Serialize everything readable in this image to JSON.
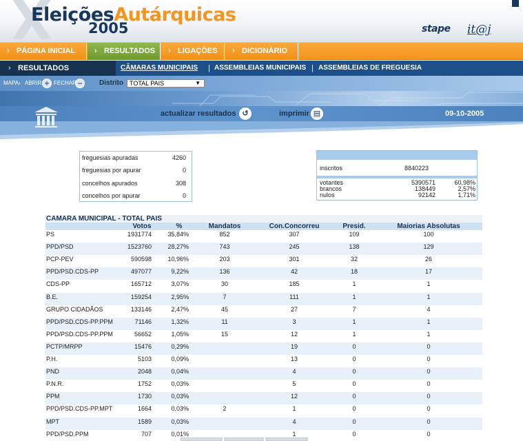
{
  "header": {
    "title_main": "Eleições",
    "title_accent": "Autárquicas",
    "title_year": "2005",
    "logo_stape": "stape",
    "logo_itij": "it@j"
  },
  "nav": {
    "items": [
      {
        "label": "PÁGINA INICIAL"
      },
      {
        "label": "RESULTADOS"
      },
      {
        "label": "LIGAÇÕES"
      },
      {
        "label": "DICIONÁRIO"
      }
    ]
  },
  "subnav": {
    "section": "RESULTADOS",
    "links": [
      {
        "label": "CÂMARAS MUNICIPAIS"
      },
      {
        "label": "ASSEMBLEIAS MUNICIPAIS"
      },
      {
        "label": "ASSEMBLEIAS DE FREGUESIA"
      }
    ],
    "separator": "|"
  },
  "toolbar": {
    "mapa_label": "MAPA",
    "abrir_label": "ABRIR",
    "fechar_label": "FECHAR",
    "distrito_label": "Distrito",
    "distrito_value": "TOTAL PAIS"
  },
  "actions": {
    "update_label": "actualizar resultados",
    "print_label": "imprimir",
    "date": "09-10-2005"
  },
  "summary_left": [
    {
      "label": "freguesias apuradas",
      "value": "4260"
    },
    {
      "label": "freguesias por apurar",
      "value": "0"
    },
    {
      "label": "concelhos apurados",
      "value": "308"
    },
    {
      "label": "concelhos por apurar",
      "value": "0"
    }
  ],
  "summary_right": {
    "inscritos_label": "inscritos",
    "inscritos_value": "8840223",
    "rows": [
      {
        "label": "votantes",
        "value": "5390571",
        "pct": "60,98%"
      },
      {
        "label": "brancos",
        "value": "138449",
        "pct": "2,57%"
      },
      {
        "label": "nulos",
        "value": "92142",
        "pct": "1,71%"
      }
    ]
  },
  "results": {
    "title": "CAMARA MUNICIPAL - TOTAL PAIS",
    "headers": [
      "Votos",
      "%",
      "Mandatos",
      "Con.Concorreu",
      "Presid.",
      "Maiorias Absolutas"
    ],
    "rows": [
      {
        "party": "PS",
        "votos": "1931774",
        "pct": "35,84%",
        "mandatos": "852",
        "concorreu": "307",
        "presid": "109",
        "maiorias": "100"
      },
      {
        "party": "PPD/PSD",
        "votos": "1523760",
        "pct": "28,27%",
        "mandatos": "743",
        "concorreu": "245",
        "presid": "138",
        "maiorias": "129"
      },
      {
        "party": "PCP-PEV",
        "votos": "590598",
        "pct": "10,96%",
        "mandatos": "203",
        "concorreu": "301",
        "presid": "32",
        "maiorias": "26"
      },
      {
        "party": "PPD/PSD.CDS-PP",
        "votos": "497077",
        "pct": "9,22%",
        "mandatos": "136",
        "concorreu": "42",
        "presid": "18",
        "maiorias": "17"
      },
      {
        "party": "CDS-PP",
        "votos": "165712",
        "pct": "3,07%",
        "mandatos": "30",
        "concorreu": "185",
        "presid": "1",
        "maiorias": "1"
      },
      {
        "party": "B.E.",
        "votos": "159254",
        "pct": "2,95%",
        "mandatos": "7",
        "concorreu": "111",
        "presid": "1",
        "maiorias": "1"
      },
      {
        "party": "GRUPO CIDADÃOS",
        "votos": "133146",
        "pct": "2,47%",
        "mandatos": "45",
        "concorreu": "27",
        "presid": "7",
        "maiorias": "4"
      },
      {
        "party": "PPD/PSD.CDS-PP.PPM",
        "votos": "71146",
        "pct": "1,32%",
        "mandatos": "11",
        "concorreu": "3",
        "presid": "1",
        "maiorias": "1"
      },
      {
        "party": "PPD/PSD.CDS-PP.PPM",
        "votos": "56652",
        "pct": "1,05%",
        "mandatos": "15",
        "concorreu": "12",
        "presid": "1",
        "maiorias": "1"
      },
      {
        "party": "PCTP/MRPP",
        "votos": "15476",
        "pct": "0,29%",
        "mandatos": "",
        "concorreu": "19",
        "presid": "0",
        "maiorias": "0"
      },
      {
        "party": "P.H.",
        "votos": "5103",
        "pct": "0,09%",
        "mandatos": "",
        "concorreu": "13",
        "presid": "0",
        "maiorias": "0"
      },
      {
        "party": "PND",
        "votos": "2048",
        "pct": "0,04%",
        "mandatos": "",
        "concorreu": "4",
        "presid": "0",
        "maiorias": "0"
      },
      {
        "party": "P.N.R.",
        "votos": "1752",
        "pct": "0,03%",
        "mandatos": "",
        "concorreu": "5",
        "presid": "0",
        "maiorias": "0"
      },
      {
        "party": "PPM",
        "votos": "1730",
        "pct": "0,03%",
        "mandatos": "",
        "concorreu": "12",
        "presid": "0",
        "maiorias": "0"
      },
      {
        "party": "PPD/PSD.CDS-PP.MPT",
        "votos": "1664",
        "pct": "0,03%",
        "mandatos": "2",
        "concorreu": "1",
        "presid": "0",
        "maiorias": "0"
      },
      {
        "party": "MPT",
        "votos": "1589",
        "pct": "0,03%",
        "mandatos": "",
        "concorreu": "4",
        "presid": "0",
        "maiorias": "0"
      },
      {
        "party": "PPD/PSD.PPM",
        "votos": "707",
        "pct": "0,01%",
        "mandatos": "",
        "concorreu": "1",
        "presid": "0",
        "maiorias": "0"
      }
    ]
  },
  "icons": {
    "chevron": "chevron-right-icon",
    "abrir": "plus-icon",
    "fechar": "minus-icon",
    "update": "refresh-icon",
    "print": "printer-icon",
    "building": "building-pillars-icon"
  },
  "colors": {
    "orange": "#f7941d",
    "green_active": "#7aa33a",
    "navy": "#17375e",
    "blue_bar": "#1d4f8b",
    "row_alt": "#e8f1fa"
  }
}
